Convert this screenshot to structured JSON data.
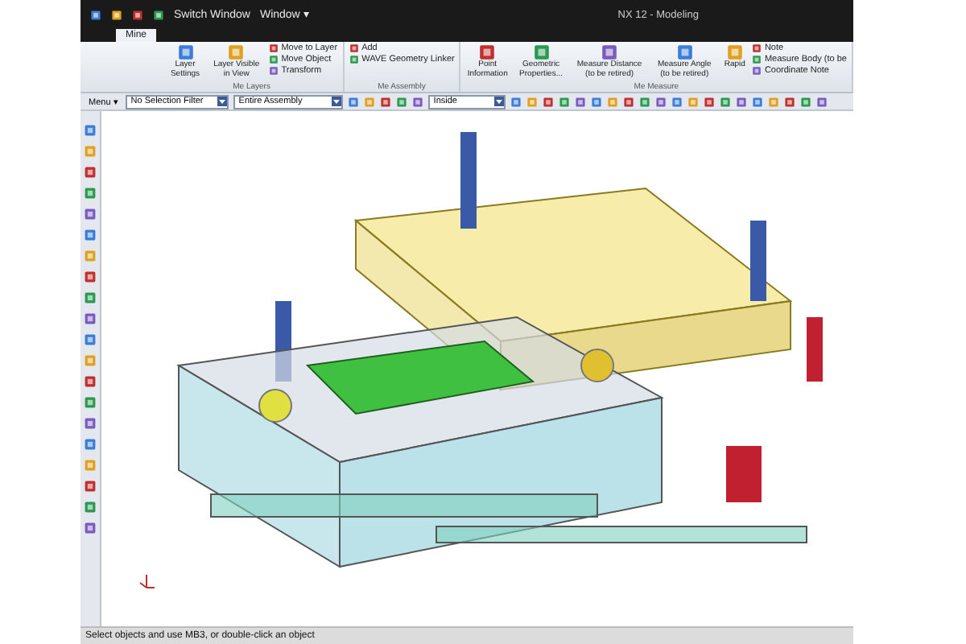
{
  "title_bar": {
    "items": [
      {
        "label": "Switch Window"
      },
      {
        "label": "Window ▾"
      }
    ],
    "title": "NX 12 - Modeling"
  },
  "tabs": [
    {
      "label": "Mine",
      "selected": true
    }
  ],
  "ribbon": [
    {
      "title": "Me Layers",
      "buttons": [
        {
          "kind": "large",
          "label": "Layer Settings"
        },
        {
          "kind": "large",
          "label": "Layer Visible in View"
        },
        {
          "kind": "small",
          "label": "Move to Layer"
        },
        {
          "kind": "small",
          "label": "Move Object"
        },
        {
          "kind": "small",
          "label": "Transform"
        }
      ]
    },
    {
      "title": "Me Assembly",
      "buttons": [
        {
          "kind": "small",
          "label": "Add"
        },
        {
          "kind": "small",
          "label": "WAVE Geometry Linker"
        }
      ]
    },
    {
      "title": "Me Measure",
      "buttons": [
        {
          "kind": "large",
          "label": "Point Information"
        },
        {
          "kind": "large",
          "label": "Geometric Properties..."
        },
        {
          "kind": "large",
          "label": "Measure Distance (to be retired)"
        },
        {
          "kind": "large",
          "label": "Measure Angle (to be retired)"
        },
        {
          "kind": "large",
          "label": "Rapid"
        },
        {
          "kind": "small",
          "label": "Note"
        },
        {
          "kind": "small",
          "label": "Measure Body (to be"
        },
        {
          "kind": "small",
          "label": "Coordinate Note"
        }
      ]
    }
  ],
  "selection_bar": {
    "menu": "Menu ▾",
    "filter": "No Selection Filter",
    "scope": "Entire Assembly",
    "mode": "Inside"
  },
  "status_bar": {
    "message": "Select objects and use MB3, or double-click an object"
  }
}
